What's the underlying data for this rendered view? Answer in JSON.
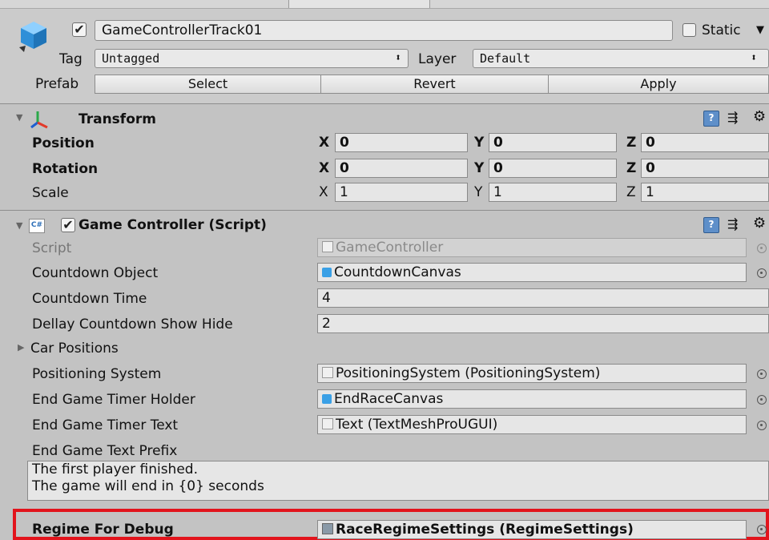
{
  "header": {
    "object_name": "GameControllerTrack01",
    "active_checked": true,
    "static_label": "Static",
    "tag_label": "Tag",
    "tag_value": "Untagged",
    "layer_label": "Layer",
    "layer_value": "Default",
    "prefab_label": "Prefab",
    "prefab_buttons": [
      "Select",
      "Revert",
      "Apply"
    ]
  },
  "transform": {
    "title": "Transform",
    "rows": [
      {
        "label": "Position",
        "x": "0",
        "y": "0",
        "z": "0",
        "bold": true
      },
      {
        "label": "Rotation",
        "x": "0",
        "y": "0",
        "z": "0",
        "bold": true
      },
      {
        "label": "Scale",
        "x": "1",
        "y": "1",
        "z": "1",
        "bold": false
      }
    ],
    "axis_labels": [
      "X",
      "Y",
      "Z"
    ]
  },
  "script_component": {
    "title": "Game Controller (Script)",
    "script_label": "Script",
    "script_value": "GameController",
    "fields": [
      {
        "label": "Countdown Object",
        "value": "CountdownCanvas",
        "icon": "cube-icon",
        "picker": true
      },
      {
        "label": "Countdown Time",
        "value": "4",
        "icon": "",
        "picker": false
      },
      {
        "label": "Dellay Countdown Show Hide",
        "value": "2",
        "icon": "",
        "picker": false
      }
    ],
    "car_positions_label": "Car Positions",
    "fields2": [
      {
        "label": "Positioning System",
        "value": "PositioningSystem (PositioningSystem)",
        "icon": "script-icon",
        "picker": true
      },
      {
        "label": "End Game Timer Holder",
        "value": "EndRaceCanvas",
        "icon": "cube-icon",
        "picker": true
      },
      {
        "label": "End Game Timer Text",
        "value": "Text (TextMeshProUGUI)",
        "icon": "script-icon",
        "picker": true
      }
    ],
    "prefix_label": "End Game Text Prefix",
    "prefix_text_line1": "The first player finished.",
    "prefix_text_line2": "The game will end in {0} seconds",
    "regime_label": "Regime For Debug",
    "regime_value": "RaceRegimeSettings (RegimeSettings)"
  },
  "colors": {
    "highlight": "#e2141c",
    "cube": "#3aa0e6"
  }
}
